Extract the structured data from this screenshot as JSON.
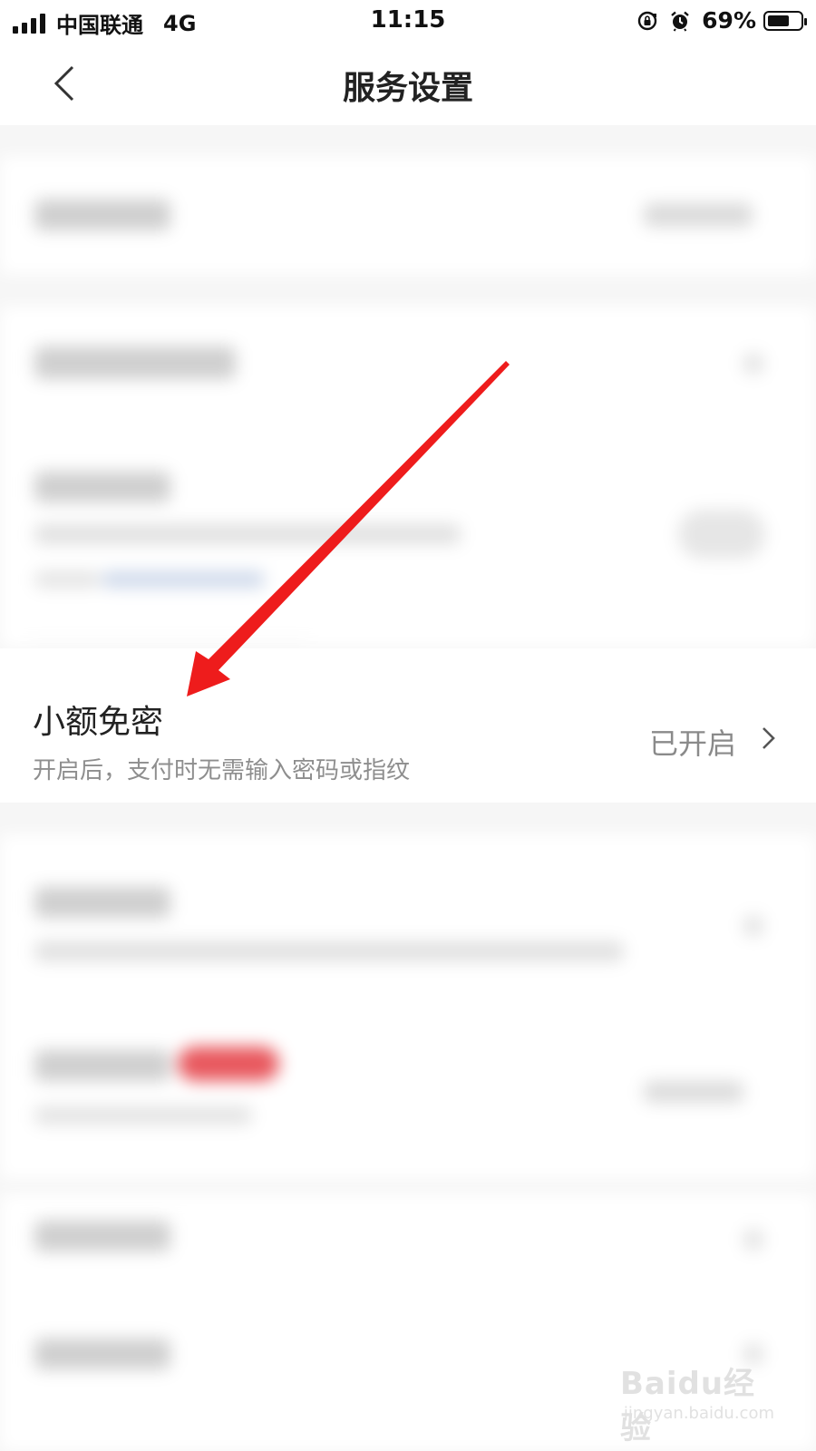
{
  "status_bar": {
    "carrier": "中国联通",
    "network": "4G",
    "time": "11:15",
    "battery_percent": "69%",
    "battery_level": 0.69,
    "icons": [
      "signal-icon",
      "rotation-lock-icon",
      "alarm-icon",
      "battery-icon"
    ]
  },
  "nav": {
    "title": "服务设置",
    "back_icon": "chevron-left-icon"
  },
  "small_payment": {
    "title": "小额免密",
    "description": "开启后，支付时无需输入密码或指纹",
    "status": "已开启",
    "chevron_icon": "chevron-right-icon"
  },
  "annotation": {
    "arrow_color": "#ee1c1c"
  },
  "watermark": {
    "logo": "Baidu经验",
    "url": "jingyan.baidu.com"
  },
  "colors": {
    "background": "#f6f6f6",
    "card": "#ffffff",
    "primary_text": "#222222",
    "secondary_text": "#8e8e8e",
    "badge": "#e8585e"
  }
}
